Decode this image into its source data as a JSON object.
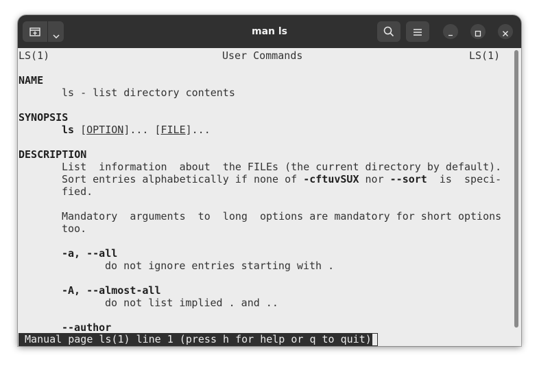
{
  "window": {
    "title": "man ls"
  },
  "icons": {
    "new_tab": "new-tab-icon",
    "dropdown": "chevron-down-icon",
    "search": "search-icon",
    "menu": "hamburger-menu-icon",
    "minimize": "minimize-icon",
    "maximize": "maximize-icon",
    "close": "close-icon"
  },
  "manpage": {
    "header_left": "LS(1)",
    "header_center": "User Commands",
    "header_right": "LS(1)",
    "name_heading": "NAME",
    "name_text": "ls - list directory contents",
    "synopsis_heading": "SYNOPSIS",
    "synopsis_cmd": "ls",
    "synopsis_open1": "[",
    "synopsis_option": "OPTION",
    "synopsis_close1": "]... [",
    "synopsis_file": "FILE",
    "synopsis_close2": "]...",
    "description_heading": "DESCRIPTION",
    "desc_line1": "List  information  about  the FILEs (the current directory by default).",
    "desc_line2_pre": "Sort entries alphabetically if none of ",
    "desc_line2_flags": "-cftuvSUX",
    "desc_line2_mid": " nor ",
    "desc_line2_sort": "--sort",
    "desc_line2_post": "  is  speci-",
    "desc_line3": "fied.",
    "desc_line4": "Mandatory  arguments  to  long  options are mandatory for short options",
    "desc_line5": "too.",
    "opt_all": "-a, --all",
    "opt_all_desc": "do not ignore entries starting with .",
    "opt_almost_all": "-A, --almost-all",
    "opt_almost_all_desc": "do not list implied . and ..",
    "opt_author": "--author"
  },
  "status_line": " Manual page ls(1) line 1 (press h for help or q to quit)",
  "colors": {
    "titlebar": "#303030",
    "terminal_bg": "#ececec",
    "terminal_fg": "#333333",
    "status_bg": "#2f2f2f"
  }
}
